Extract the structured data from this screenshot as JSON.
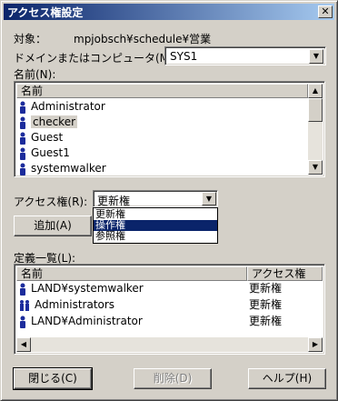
{
  "window": {
    "title": "アクセス権設定",
    "close_glyph": "✕"
  },
  "target": {
    "label": "対象：",
    "value": "mpjobsch¥schedule¥営業"
  },
  "domain": {
    "label": "ドメインまたはコンピュータ(M):",
    "value": "SYS1"
  },
  "names": {
    "label": "名前(N):",
    "header": "名前",
    "items": [
      {
        "name": "Administrator",
        "icon": "user-icon"
      },
      {
        "name": "checker",
        "icon": "user-icon"
      },
      {
        "name": "Guest",
        "icon": "user-icon"
      },
      {
        "name": "Guest1",
        "icon": "user-icon"
      },
      {
        "name": "systemwalker",
        "icon": "user-icon"
      }
    ]
  },
  "access": {
    "label": "アクセス権(R):",
    "value": "更新権",
    "options": [
      "更新権",
      "操作権",
      "参照権"
    ],
    "highlighted": "操作権"
  },
  "add_button": "追加(A)",
  "definitions": {
    "label": "定義一覧(L):",
    "headers": [
      "名前",
      "アクセス権"
    ],
    "rows": [
      {
        "name": "LAND¥systemwalker",
        "right": "更新権",
        "icon": "user-icon"
      },
      {
        "name": "Administrators",
        "right": "更新権",
        "icon": "group-icon"
      },
      {
        "name": "LAND¥Administrator",
        "right": "更新権",
        "icon": "user-icon"
      }
    ]
  },
  "buttons": {
    "close": "閉じる(C)",
    "delete": "削除(D)",
    "help": "ヘルプ(H)"
  },
  "colors": {
    "titlebar": "#0a246a",
    "user_icon": "#1c2c9c",
    "selection": "#0a246a"
  }
}
